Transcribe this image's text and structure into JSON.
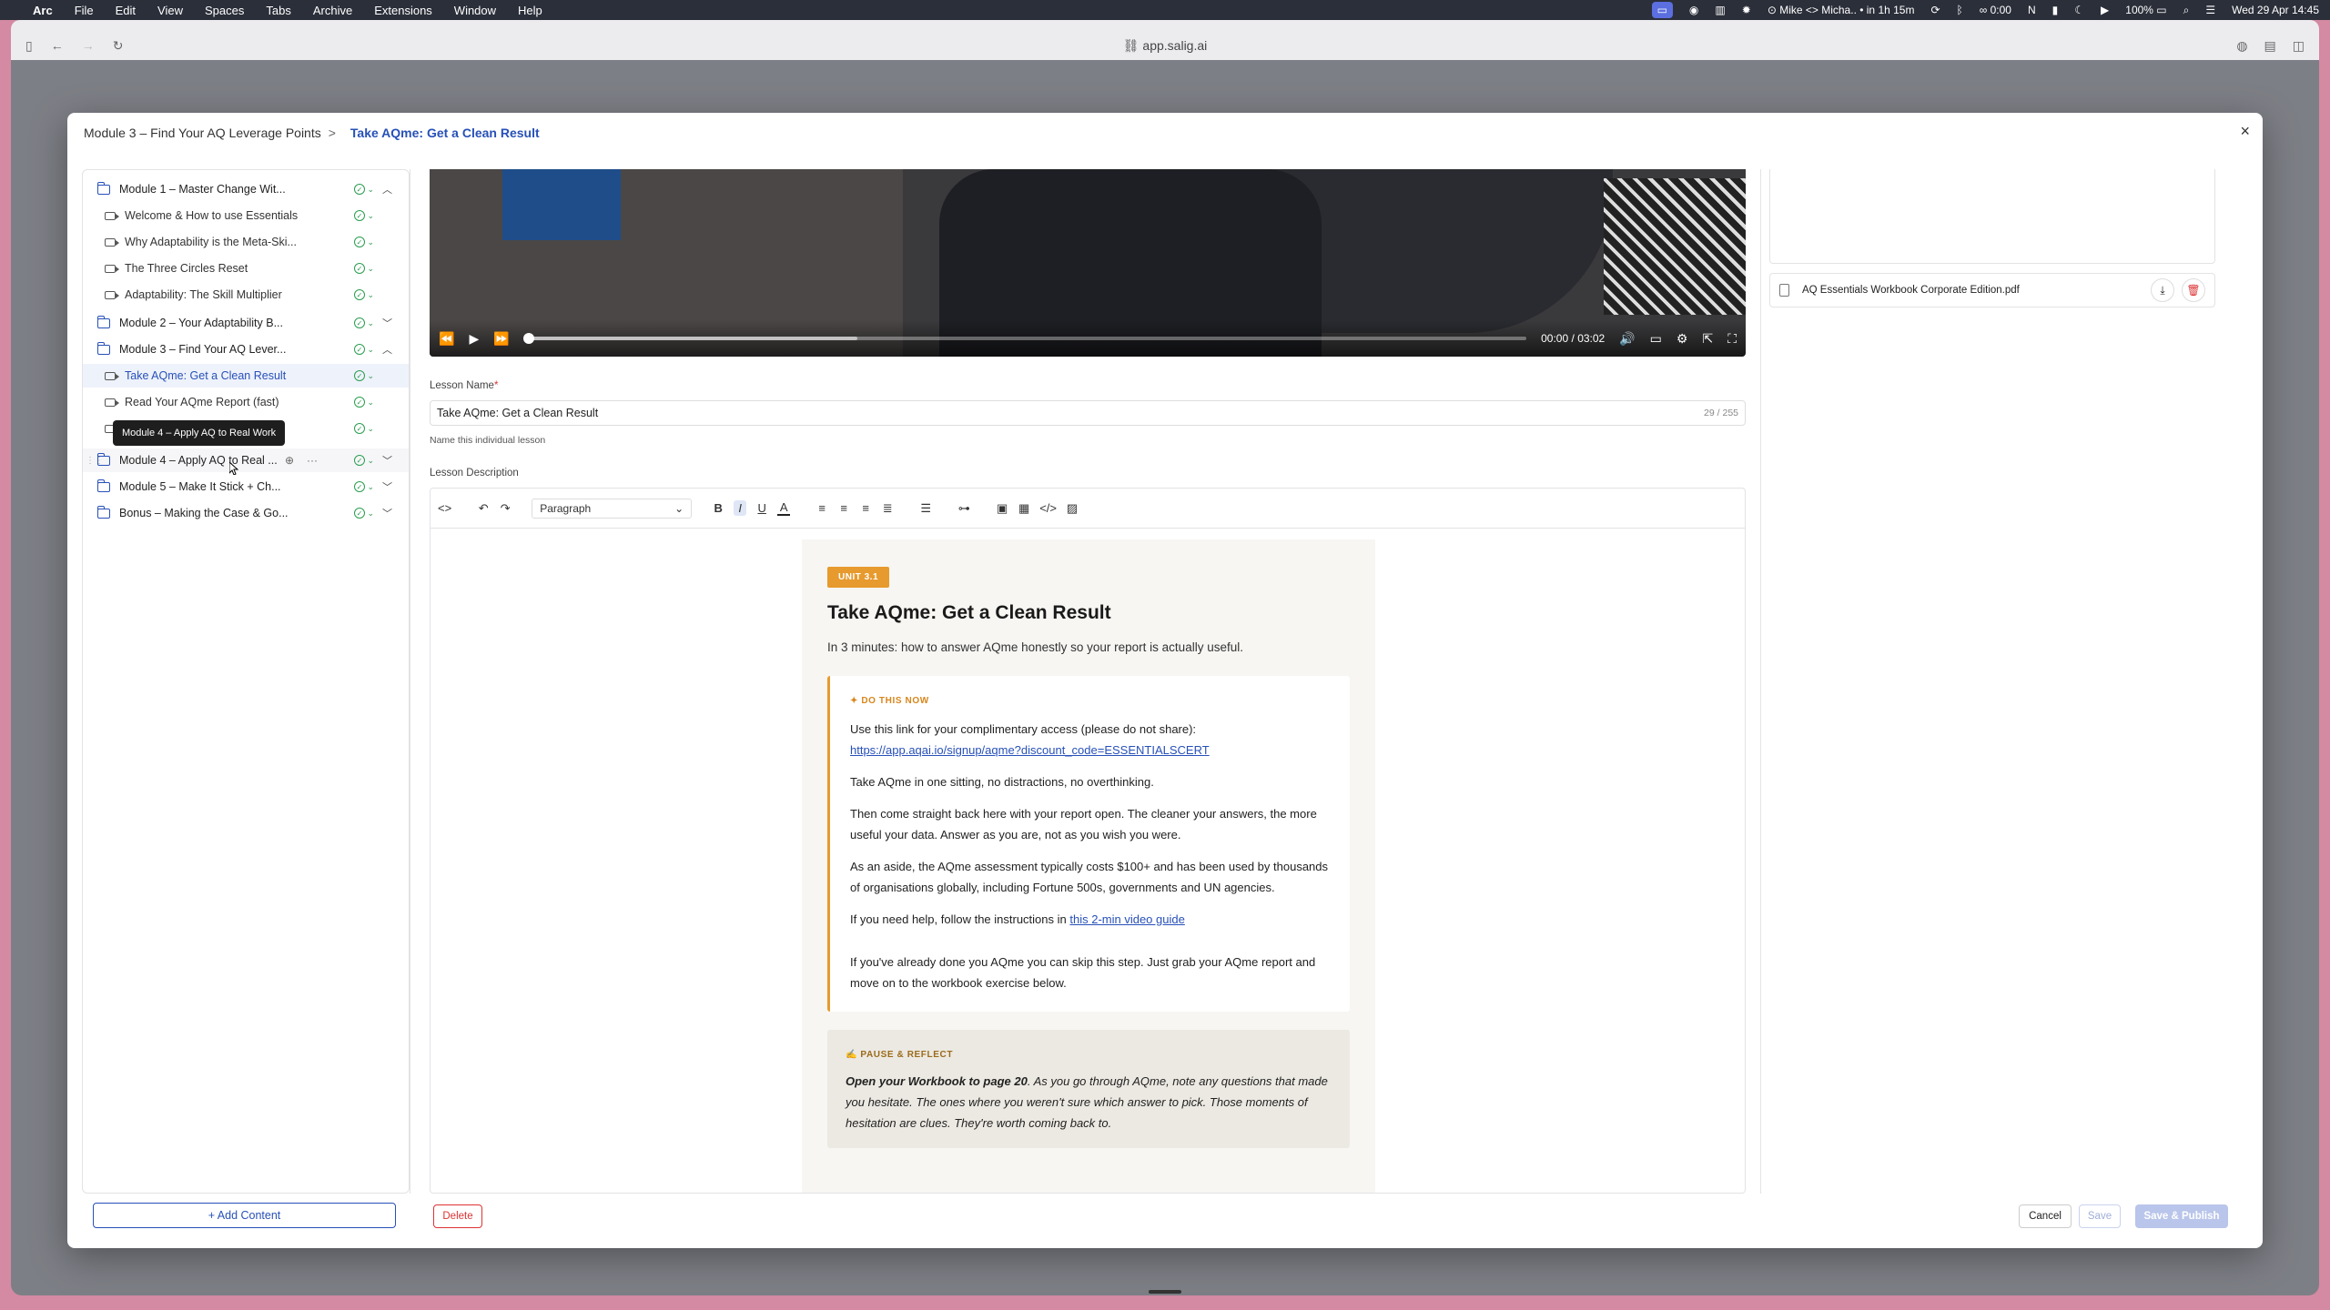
{
  "menubar": {
    "app": "Arc",
    "menus": [
      "File",
      "Edit",
      "View",
      "Spaces",
      "Tabs",
      "Archive",
      "Extensions",
      "Window",
      "Help"
    ],
    "meeting": "Mike <> Micha.. • in 1h 15m",
    "timer": "0:00",
    "battery": "100%",
    "datetime": "Wed 29 Apr  14:45"
  },
  "browser": {
    "url": "app.salig.ai"
  },
  "modal": {
    "breadcrumb_parent": "Module 3 – Find Your AQ Leverage Points",
    "breadcrumb_sep": ">",
    "breadcrumb_current": "Take AQme: Get a Clean Result",
    "close": "×"
  },
  "tree": {
    "rows": [
      {
        "type": "module",
        "label": "Module 1 – Master Change Wit...",
        "chev": "^"
      },
      {
        "type": "lesson",
        "label": "Welcome & How to use Essentials"
      },
      {
        "type": "lesson",
        "label": "Why Adaptability is the Meta-Ski..."
      },
      {
        "type": "lesson",
        "label": "The Three Circles Reset"
      },
      {
        "type": "lesson",
        "label": "Adaptability: The Skill Multiplier"
      },
      {
        "type": "module",
        "label": "Module 2 – Your Adaptability B...",
        "chev": "v"
      },
      {
        "type": "module",
        "label": "Module 3 – Find Your AQ Lever...",
        "chev": "^"
      },
      {
        "type": "lesson",
        "label": "Take AQme: Get a Clean Result",
        "active": true
      },
      {
        "type": "lesson",
        "label": "Read Your AQme Report (fast)"
      },
      {
        "type": "lesson",
        "label": ""
      },
      {
        "type": "module",
        "label": "Module 4 – Apply AQ to Real ...",
        "chev": "v",
        "hover": true
      },
      {
        "type": "module",
        "label": "Module 5 – Make It Stick + Ch...",
        "chev": "v"
      },
      {
        "type": "module",
        "label": "Bonus – Making the Case & Go...",
        "chev": "v"
      }
    ],
    "tooltip": "Module 4 – Apply AQ to Real Work",
    "add_button": "+ Add Content"
  },
  "video": {
    "current_time": "00:00",
    "separator": "/",
    "duration": "03:02",
    "buffered_fraction": 0.33
  },
  "lesson": {
    "name_label": "Lesson Name",
    "required_mark": "*",
    "name_value": "Take AQme: Get a Clean Result",
    "name_count": "29 / 255",
    "name_help": "Name this individual lesson",
    "description_label": "Lesson Description"
  },
  "toolbar": {
    "block_style": "Paragraph"
  },
  "content": {
    "unit_badge": "UNIT 3.1",
    "title": "Take AQme: Get a Clean Result",
    "intro": "In 3 minutes: how to answer AQme honestly so your report is actually useful.",
    "callout_tag": "✦ DO THIS NOW",
    "p1": "Use this link for your complimentary access (please do not share):",
    "link1": "https://app.aqai.io/signup/aqme?discount_code=ESSENTIALSCERT",
    "p2": "Take AQme in one sitting, no distractions, no overthinking.",
    "p3": "Then come straight back here with your report open. The cleaner your answers, the more useful your data. Answer as you are, not as you wish you were.",
    "p4": "As an aside, the AQme assessment typically costs $100+ and has been used by thousands of organisations globally, including Fortune 500s, governments and UN agencies.",
    "p5_pre": "If you need help, follow the instructions in ",
    "p5_link": "this 2-min video guide",
    "p6": "If you've already done you AQme you can skip this step. Just grab your AQme report and move on to the workbook exercise below.",
    "reflect_tag": "✍ PAUSE & REFLECT",
    "reflect_bold": "Open your Workbook to page 20",
    "reflect_text": ". As you go through AQme, note any questions that made you hesitate. The ones where you weren't sure which answer to pick. Those moments of hesitation are clues. They're worth coming back to."
  },
  "attachment": {
    "filename": "AQ Essentials Workbook Corporate Edition.pdf"
  },
  "footer": {
    "delete": "Delete",
    "cancel": "Cancel",
    "save": "Save",
    "publish": "Save & Publish"
  },
  "colors": {
    "accent": "#2750b8",
    "orange": "#e79a2d",
    "success": "#2a9d4f",
    "danger": "#dd3333"
  }
}
